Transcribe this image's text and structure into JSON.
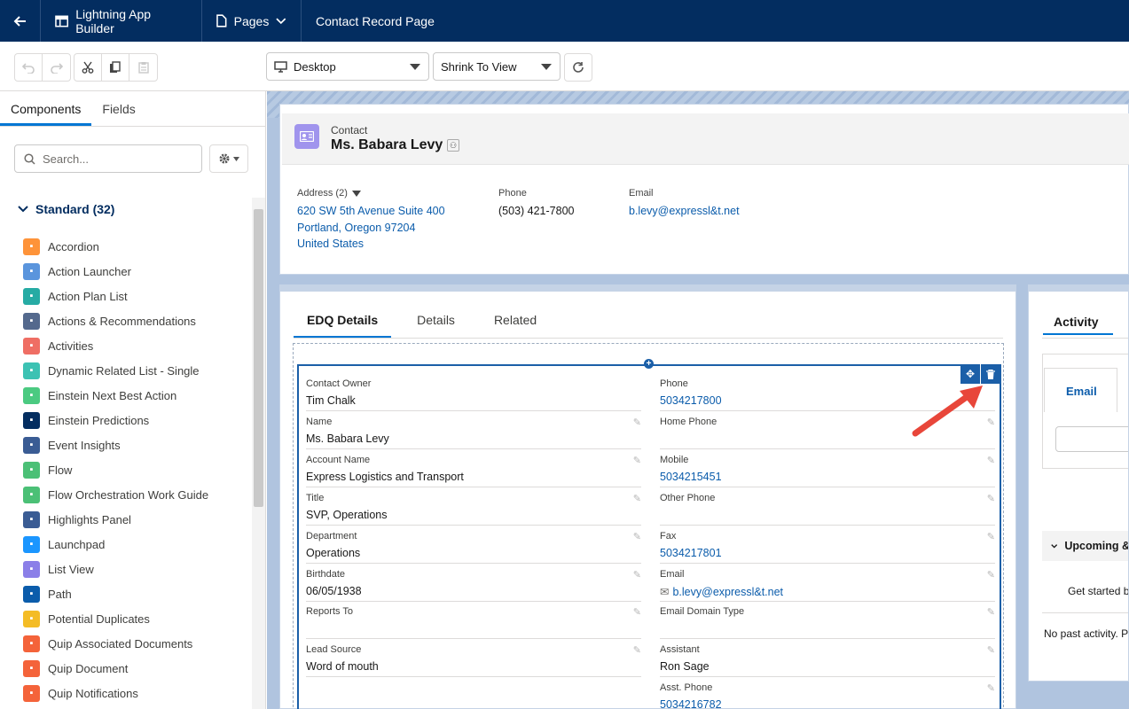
{
  "topbar": {
    "app_name": "Lightning App Builder",
    "pages_label": "Pages",
    "page_title": "Contact Record Page"
  },
  "toolbar": {
    "device_select": "Desktop",
    "view_select": "Shrink To View"
  },
  "sidebar": {
    "tabs": [
      "Components",
      "Fields"
    ],
    "search_placeholder": "Search...",
    "section_title": "Standard (32)",
    "components": [
      {
        "label": "Accordion",
        "icon": "accordion-icon",
        "color": "#fe9339"
      },
      {
        "label": "Action Launcher",
        "icon": "lightning-icon",
        "color": "#5a95dd"
      },
      {
        "label": "Action Plan List",
        "icon": "action-plan-icon",
        "color": "#26aba4"
      },
      {
        "label": "Actions & Recommendations",
        "icon": "list-icon",
        "color": "#54698d"
      },
      {
        "label": "Activities",
        "icon": "activities-icon",
        "color": "#ef6e64"
      },
      {
        "label": "Dynamic Related List - Single",
        "icon": "related-list-icon",
        "color": "#3cc2b3"
      },
      {
        "label": "Einstein Next Best Action",
        "icon": "einstein-action-icon",
        "color": "#4bca81"
      },
      {
        "label": "Einstein Predictions",
        "icon": "einstein-predictions-icon",
        "color": "#032d60"
      },
      {
        "label": "Event Insights",
        "icon": "event-insights-icon",
        "color": "#3a5c94"
      },
      {
        "label": "Flow",
        "icon": "flow-icon",
        "color": "#4bc076"
      },
      {
        "label": "Flow Orchestration Work Guide",
        "icon": "flow-orchestration-icon",
        "color": "#4bc076"
      },
      {
        "label": "Highlights Panel",
        "icon": "highlights-icon",
        "color": "#3a5c94"
      },
      {
        "label": "Launchpad",
        "icon": "launchpad-icon",
        "color": "#1b96ff"
      },
      {
        "label": "List View",
        "icon": "list-view-icon",
        "color": "#8b7fe8"
      },
      {
        "label": "Path",
        "icon": "path-icon",
        "color": "#0b5cab"
      },
      {
        "label": "Potential Duplicates",
        "icon": "duplicates-icon",
        "color": "#f4bc25"
      },
      {
        "label": "Quip Associated Documents",
        "icon": "quip-icon",
        "color": "#f4633a"
      },
      {
        "label": "Quip Document",
        "icon": "quip-icon",
        "color": "#f4633a"
      },
      {
        "label": "Quip Notifications",
        "icon": "quip-icon",
        "color": "#f4633a"
      }
    ]
  },
  "record": {
    "object_type": "Contact",
    "name": "Ms. Babara Levy",
    "address_label": "Address (2)",
    "address_line1": "620 SW 5th Avenue Suite 400",
    "address_line2": "Portland, Oregon 97204",
    "address_line3": "United States",
    "phone_label": "Phone",
    "phone_value": "(503) 421-7800",
    "email_label": "Email",
    "email_value": "b.levy@expressl&t.net"
  },
  "detail_tabs": [
    "EDQ Details",
    "Details",
    "Related"
  ],
  "left_fields": [
    {
      "label": "Contact Owner",
      "value": "Tim Chalk",
      "editable": false
    },
    {
      "label": "Name",
      "value": "Ms. Babara Levy",
      "editable": true
    },
    {
      "label": "Account Name",
      "value": "Express Logistics and Transport",
      "editable": true
    },
    {
      "label": "Title",
      "value": "SVP, Operations",
      "editable": true
    },
    {
      "label": "Department",
      "value": "Operations",
      "editable": true
    },
    {
      "label": "Birthdate",
      "value": "06/05/1938",
      "editable": true
    },
    {
      "label": "Reports To",
      "value": "",
      "editable": true
    },
    {
      "label": "Lead Source",
      "value": "Word of mouth",
      "editable": true
    }
  ],
  "right_fields": [
    {
      "label": "Phone",
      "value": "5034217800",
      "link": true,
      "editable": false
    },
    {
      "label": "Home Phone",
      "value": "",
      "link": false,
      "editable": true
    },
    {
      "label": "Mobile",
      "value": "5034215451",
      "link": true,
      "editable": true
    },
    {
      "label": "Other Phone",
      "value": "",
      "link": false,
      "editable": true
    },
    {
      "label": "Fax",
      "value": "5034217801",
      "link": true,
      "editable": true
    },
    {
      "label": "Email",
      "value": "b.levy@expressl&t.net",
      "link": true,
      "editable": true,
      "mail_icon": true
    },
    {
      "label": "Email Domain Type",
      "value": "",
      "link": false,
      "editable": true
    },
    {
      "label": "Assistant",
      "value": "Ron Sage",
      "link": false,
      "editable": true
    },
    {
      "label": "Asst. Phone",
      "value": "5034216782",
      "link": true,
      "editable": true
    }
  ],
  "activity": {
    "title": "Activity",
    "email_tab": "Email",
    "upcoming": "Upcoming &",
    "get_started": "Get started by",
    "no_past": "No past activity. Pa"
  }
}
